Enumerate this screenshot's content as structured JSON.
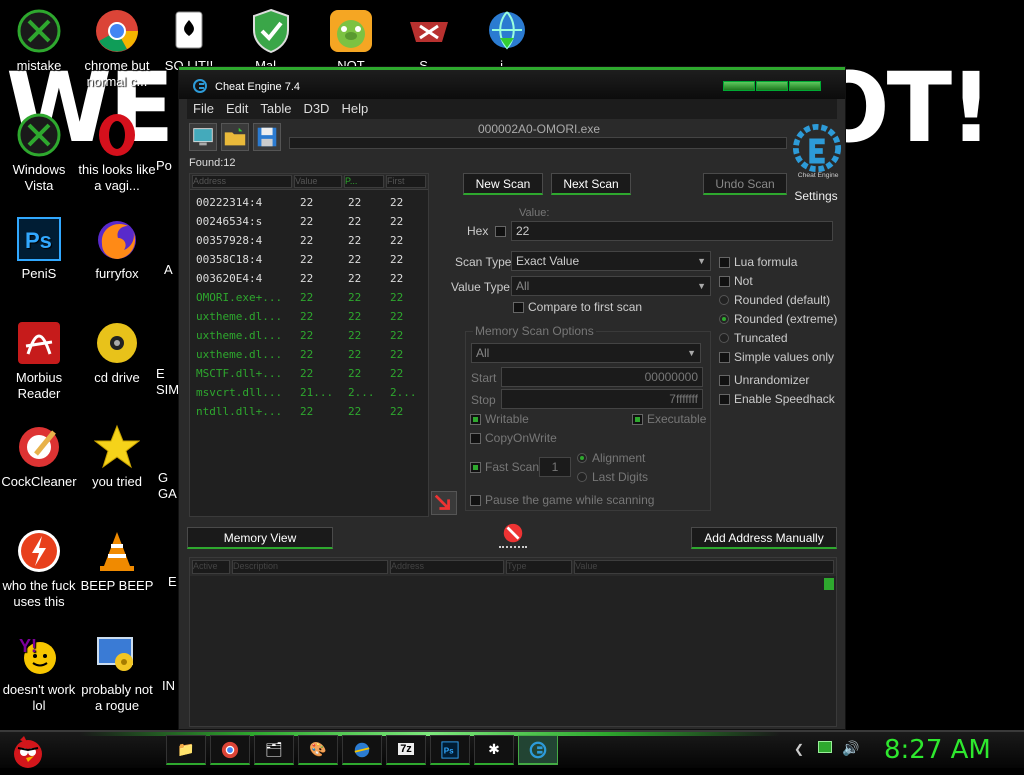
{
  "wallpaper": {
    "left_text": "WE",
    "right_text": "OT!"
  },
  "desktop_icons": [
    {
      "label": "mistake",
      "icon": "xbox-icon"
    },
    {
      "label": "chrome but normal c...",
      "icon": "chrome-icon"
    },
    {
      "label": "SO LIT!!",
      "icon": "solitaire-icon"
    },
    {
      "label": "Mal...",
      "icon": "shield-icon"
    },
    {
      "label": "NOT",
      "icon": "angry-birds-pig-icon"
    },
    {
      "label": "S...",
      "icon": "papers-please-icon"
    },
    {
      "label": "i...",
      "icon": "download-globe-icon"
    },
    {
      "label": "Windows Vista",
      "icon": "xbox-icon"
    },
    {
      "label": "this looks like a vagi...",
      "icon": "opera-icon"
    },
    {
      "label": "Po",
      "icon": "app-icon"
    },
    {
      "label": "PeniS",
      "icon": "photoshop-icon"
    },
    {
      "label": "furryfox",
      "icon": "firefox-icon"
    },
    {
      "label": "A",
      "icon": "app-icon"
    },
    {
      "label": "Morbius Reader",
      "icon": "acrobat-icon"
    },
    {
      "label": "cd drive",
      "icon": "cd-icon"
    },
    {
      "label": "E SIM",
      "icon": "app-icon"
    },
    {
      "label": "CockCleaner",
      "icon": "ccleaner-icon"
    },
    {
      "label": "you tried",
      "icon": "star-icon"
    },
    {
      "label": "G GA",
      "icon": "app-icon"
    },
    {
      "label": "who the fuck uses this",
      "icon": "flash-icon"
    },
    {
      "label": "BEEP BEEP",
      "icon": "vlc-icon"
    },
    {
      "label": "E",
      "icon": "app-icon"
    },
    {
      "label": "doesn't work lol",
      "icon": "yahoo-messenger-icon"
    },
    {
      "label": "probably not a rogue",
      "icon": "control-panel-icon"
    },
    {
      "label": "IN",
      "icon": "app-icon"
    }
  ],
  "window": {
    "title": "Cheat Engine 7.4",
    "menu": [
      "File",
      "Edit",
      "Table",
      "D3D",
      "Help"
    ],
    "process_name": "000002A0-OMORI.exe",
    "found": "Found:12",
    "settings_label": "Settings",
    "logo_text": "Cheat Engine"
  },
  "results": {
    "headers": [
      "Address",
      "Value",
      "P...",
      "First"
    ],
    "rows": [
      {
        "address": "00222314:4",
        "value": "22",
        "previous": "22",
        "first": "22",
        "style": "normal"
      },
      {
        "address": "00246534:s",
        "value": "22",
        "previous": "22",
        "first": "22",
        "style": "normal"
      },
      {
        "address": "00357928:4",
        "value": "22",
        "previous": "22",
        "first": "22",
        "style": "normal"
      },
      {
        "address": "00358C18:4",
        "value": "22",
        "previous": "22",
        "first": "22",
        "style": "normal"
      },
      {
        "address": "003620E4:4",
        "value": "22",
        "previous": "22",
        "first": "22",
        "style": "normal"
      },
      {
        "address": "OMORI.exe+...",
        "value": "22",
        "previous": "22",
        "first": "22",
        "style": "green"
      },
      {
        "address": "uxtheme.dl...",
        "value": "22",
        "previous": "22",
        "first": "22",
        "style": "green"
      },
      {
        "address": "uxtheme.dl...",
        "value": "22",
        "previous": "22",
        "first": "22",
        "style": "green"
      },
      {
        "address": "uxtheme.dl...",
        "value": "22",
        "previous": "22",
        "first": "22",
        "style": "green"
      },
      {
        "address": "MSCTF.dll+...",
        "value": "22",
        "previous": "22",
        "first": "22",
        "style": "green"
      },
      {
        "address": "msvcrt.dll...",
        "value": "21...",
        "previous": "2...",
        "first": "2...",
        "style": "green"
      },
      {
        "address": "ntdll.dll+...",
        "value": "22",
        "previous": "22",
        "first": "22",
        "style": "green"
      }
    ]
  },
  "scan": {
    "new_scan": "New Scan",
    "next_scan": "Next Scan",
    "undo_scan": "Undo Scan",
    "value_label": "Value:",
    "hex_label": "Hex",
    "value_input": "22",
    "scan_type_label": "Scan Type",
    "scan_type_value": "Exact Value",
    "value_type_label": "Value Type",
    "value_type_value": "All",
    "compare_first": "Compare to first scan",
    "lua_formula": "Lua formula",
    "not": "Not",
    "rounded_default": "Rounded (default)",
    "rounded_extreme": "Rounded (extreme)",
    "truncated": "Truncated",
    "simple_values": "Simple values only",
    "unrandomizer": "Unrandomizer",
    "enable_speedhack": "Enable Speedhack"
  },
  "memory_scan": {
    "title": "Memory Scan Options",
    "region": "All",
    "start_label": "Start",
    "start_value": "00000000",
    "stop_label": "Stop",
    "stop_value": "7fffffff",
    "writable": "Writable",
    "executable": "Executable",
    "copy_on_write": "CopyOnWrite",
    "fast_scan": "Fast Scan",
    "fast_scan_value": "1",
    "alignment": "Alignment",
    "last_digits": "Last Digits",
    "pause_game": "Pause the game while scanning"
  },
  "bottom": {
    "memory_view": "Memory View",
    "add_address": "Add Address Manually",
    "headers": [
      "Active",
      "Description",
      "Address",
      "Type",
      "Value"
    ]
  },
  "taskbar": {
    "clock": "8:27 AM",
    "items": [
      "folder-icon",
      "chrome-icon",
      "pictures-icon",
      "paint-icon",
      "ie-icon",
      "7zip-icon",
      "photoshop-icon",
      "spider-icon",
      "cheat-engine-icon"
    ]
  },
  "colors": {
    "accent": "#2ea82e",
    "clock": "#2ee82e"
  }
}
